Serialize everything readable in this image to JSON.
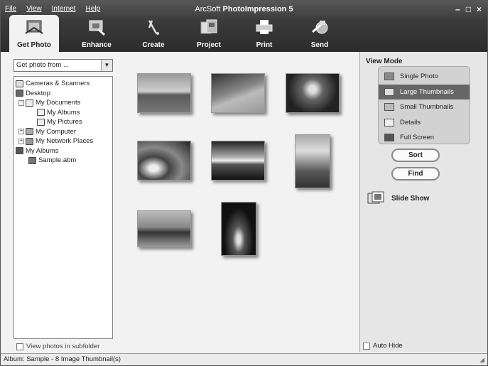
{
  "menu": [
    "File",
    "View",
    "Internet",
    "Help"
  ],
  "app_title": {
    "prefix": "ArcSoft ",
    "name": "PhotoImpression 5"
  },
  "window_controls": [
    "–",
    "□",
    "×"
  ],
  "toolbar": [
    {
      "label": "Get Photo",
      "icon": "get-photo-icon",
      "active": true
    },
    {
      "label": "Enhance",
      "icon": "enhance-icon"
    },
    {
      "label": "Create",
      "icon": "create-icon"
    },
    {
      "label": "Project",
      "icon": "project-icon"
    },
    {
      "label": "Print",
      "icon": "print-icon"
    },
    {
      "label": "Send",
      "icon": "send-icon"
    }
  ],
  "get_photo_from": {
    "value": "Get photo from ..."
  },
  "tree": [
    {
      "label": "Cameras & Scanners",
      "depth": 0,
      "icon": "camera-icon"
    },
    {
      "label": "Desktop",
      "depth": 0,
      "icon": "desktop-icon"
    },
    {
      "label": "My Documents",
      "depth": 1,
      "icon": "folder-icon",
      "expander": "−"
    },
    {
      "label": "My Albums",
      "depth": 2,
      "icon": "folder-icon"
    },
    {
      "label": "My Pictures",
      "depth": 2,
      "icon": "folder-icon"
    },
    {
      "label": "My Computer",
      "depth": 1,
      "icon": "computer-icon",
      "expander": "+"
    },
    {
      "label": "My Network Places",
      "depth": 1,
      "icon": "network-icon",
      "expander": "+"
    },
    {
      "label": "My Albums",
      "depth": 0,
      "icon": "album-icon"
    },
    {
      "label": "Sample.abm",
      "depth": 1,
      "icon": "album-file-icon"
    }
  ],
  "subfolder_label": "View photos in subfolder",
  "view_mode": {
    "title": "View Mode",
    "options": [
      {
        "label": "Single Photo",
        "icon": "single-photo-icon"
      },
      {
        "label": "Large Thumbnails",
        "icon": "large-thumbnails-icon",
        "selected": true
      },
      {
        "label": "Small Thumbnails",
        "icon": "small-thumbnails-icon"
      },
      {
        "label": "Details",
        "icon": "details-icon"
      },
      {
        "label": "Full Screen",
        "icon": "full-screen-icon"
      }
    ]
  },
  "sort_label": "Sort",
  "find_label": "Find",
  "slideshow_label": "Slide Show",
  "autohide_label": "Auto Hide",
  "status": "Album: Sample - 8 Image Thumbnail(s)"
}
